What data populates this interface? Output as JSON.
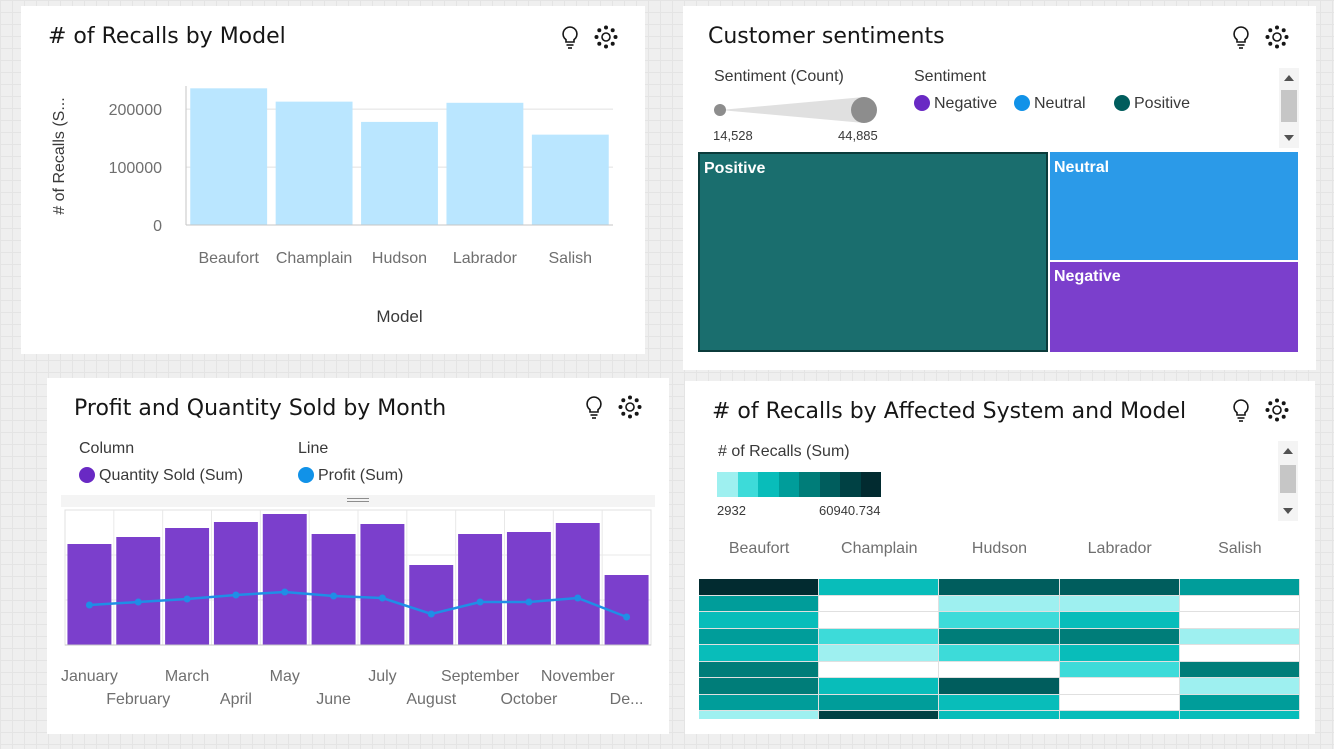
{
  "panel_recalls_model": {
    "title": "# of Recalls by Model",
    "chart_data": {
      "type": "bar",
      "title": "# of Recalls by Model",
      "xlabel": "Model",
      "ylabel": "# of Recalls (S...",
      "categories": [
        "Beaufort",
        "Champlain",
        "Hudson",
        "Labrador",
        "Salish"
      ],
      "values": [
        236000,
        213000,
        178000,
        211000,
        156000
      ],
      "yticks": [
        "0",
        "100000",
        "200000"
      ],
      "ylim": [
        0,
        240000
      ],
      "grid": true,
      "color": "#bae6ff"
    }
  },
  "panel_sentiments": {
    "title": "Customer sentiments",
    "slider": {
      "label": "Sentiment (Count)",
      "min_label": "14,528",
      "max_label": "44,885"
    },
    "legend": {
      "title": "Sentiment",
      "items": [
        {
          "label": "Negative",
          "color": "#6929c4"
        },
        {
          "label": "Neutral",
          "color": "#1192e8"
        },
        {
          "label": "Positive",
          "color": "#005d5d"
        }
      ]
    },
    "chart_data": {
      "type": "treemap",
      "items": [
        {
          "label": "Positive",
          "value": 44885,
          "color": "#1a6e6e"
        },
        {
          "label": "Neutral",
          "value": 14900,
          "color": "#2b9ae8"
        },
        {
          "label": "Negative",
          "value": 14528,
          "color": "#7b3fcc"
        }
      ]
    }
  },
  "panel_profit": {
    "title": "Profit and Quantity Sold by Month",
    "legend": {
      "column_header": "Column",
      "line_header": "Line",
      "column_item": {
        "label": "Quantity Sold (Sum)",
        "color": "#6929c4"
      },
      "line_item": {
        "label": "Profit (Sum)",
        "color": "#1192e8"
      }
    },
    "chart_data": {
      "type": "bar",
      "categories": [
        "January",
        "February",
        "March",
        "April",
        "May",
        "June",
        "July",
        "August",
        "September",
        "October",
        "November",
        "De..."
      ],
      "series": [
        {
          "name": "Quantity Sold (Sum)",
          "type": "bar",
          "values": [
            101,
            108,
            117,
            123,
            131,
            111,
            121,
            80,
            111,
            113,
            122,
            70
          ]
        },
        {
          "name": "Profit (Sum)",
          "type": "line",
          "values": [
            40,
            43,
            46,
            50,
            53,
            49,
            47,
            31,
            43,
            43,
            47,
            28
          ]
        }
      ],
      "ylim": [
        0,
        135
      ],
      "grid": true
    }
  },
  "panel_affected": {
    "title": "# of Recalls by Affected System and Model",
    "scale": {
      "label": "# of Recalls (Sum)",
      "min_label": "2932",
      "max_label": "60940.734",
      "colors": [
        "#9ef0f0",
        "#3ddbd9",
        "#08bdba",
        "#009d9a",
        "#007d79",
        "#005d5d",
        "#004144",
        "#022b30"
      ]
    },
    "chart_data": {
      "type": "heatmap",
      "columns": [
        "Beaufort",
        "Champlain",
        "Hudson",
        "Labrador",
        "Salish"
      ],
      "levels": [
        [
          7,
          2,
          5,
          5,
          3
        ],
        [
          3,
          -1,
          0,
          0,
          -1
        ],
        [
          2,
          -1,
          1,
          2,
          -1
        ],
        [
          3,
          1,
          4,
          4,
          0
        ],
        [
          2,
          0,
          1,
          2,
          -1
        ],
        [
          4,
          -1,
          -1,
          1,
          4
        ],
        [
          4,
          2,
          5,
          -1,
          0
        ],
        [
          3,
          3,
          2,
          -1,
          3
        ],
        [
          0,
          6,
          2,
          2,
          2
        ]
      ]
    }
  }
}
